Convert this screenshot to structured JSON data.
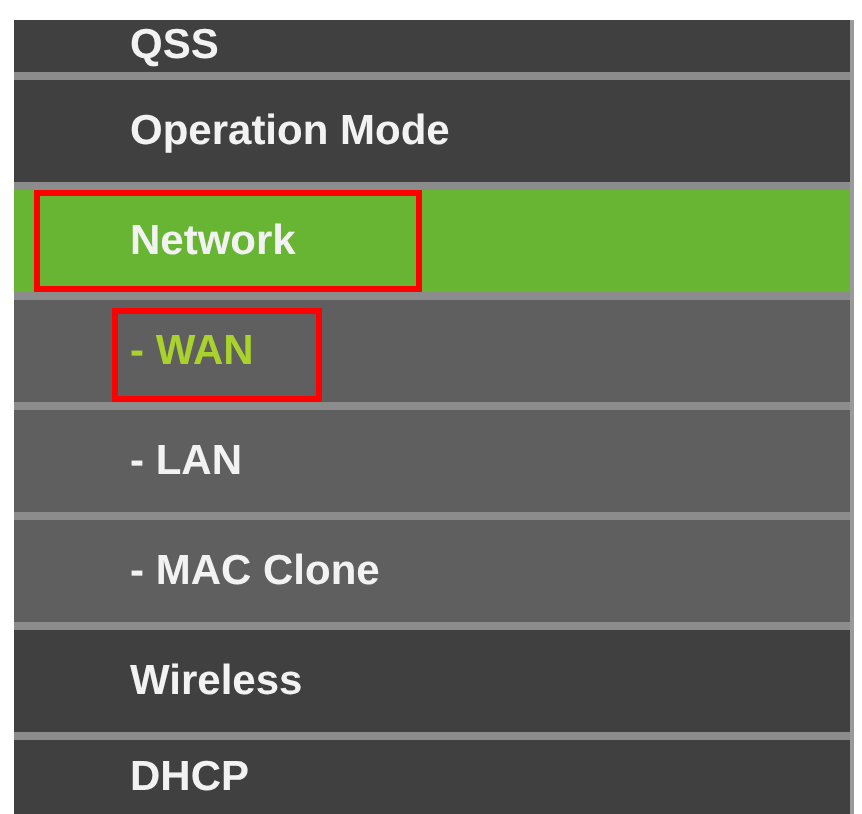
{
  "menu": {
    "items": [
      {
        "kind": "main",
        "label": "QSS",
        "selected": false,
        "annotated": false
      },
      {
        "kind": "main",
        "label": "Operation Mode",
        "selected": false,
        "annotated": false
      },
      {
        "kind": "main",
        "label": "Network",
        "selected": true,
        "annotated": true
      },
      {
        "kind": "sub",
        "label": "- WAN",
        "selected": true,
        "annotated": true
      },
      {
        "kind": "sub",
        "label": "- LAN",
        "selected": false,
        "annotated": false
      },
      {
        "kind": "sub",
        "label": "- MAC Clone",
        "selected": false,
        "annotated": false
      },
      {
        "kind": "main",
        "label": "Wireless",
        "selected": false,
        "annotated": false
      },
      {
        "kind": "main",
        "label": "DHCP",
        "selected": false,
        "annotated": false
      }
    ]
  }
}
